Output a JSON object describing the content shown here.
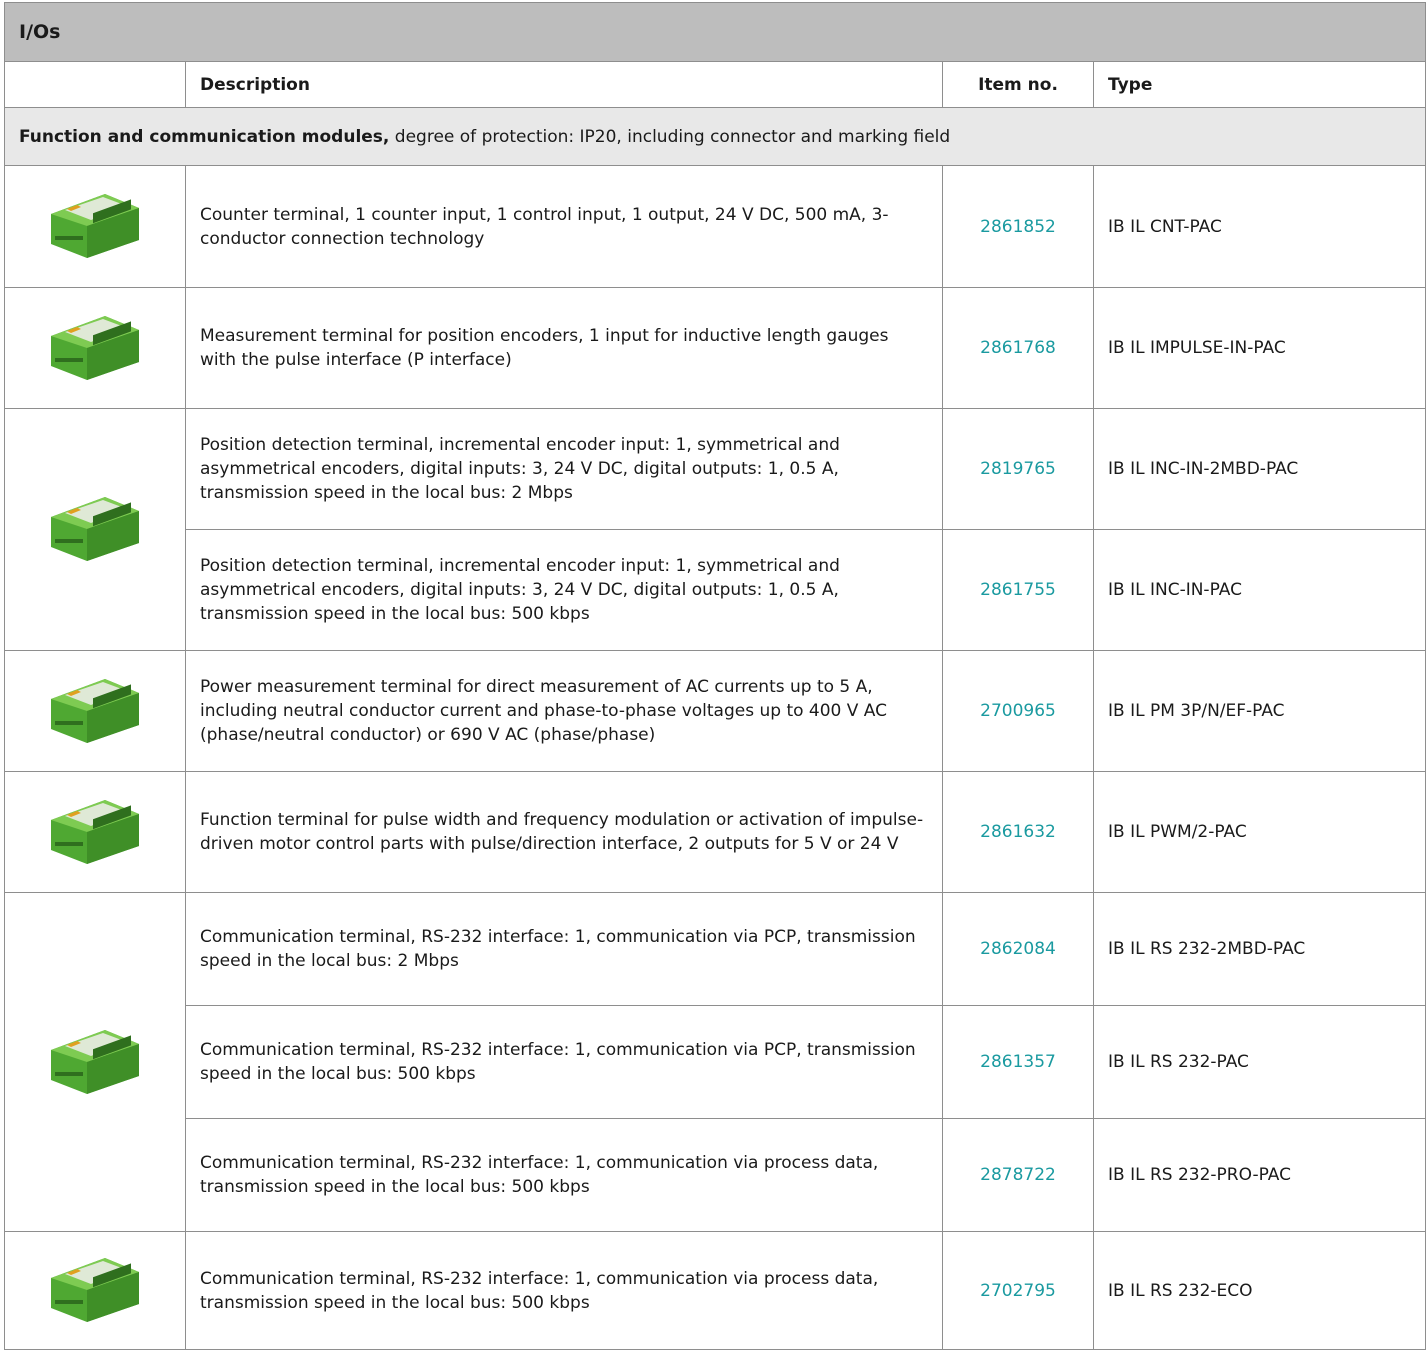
{
  "table_title": "I/Os",
  "headers": {
    "image": "",
    "description": "Description",
    "item_no": "Item no.",
    "type": "Type"
  },
  "group": {
    "title_bold": "Function and communication modules,",
    "title_rest": " degree of protection: IP20, including connector and marking field"
  },
  "rows": [
    {
      "description": "Counter terminal, 1 counter input, 1 control input, 1 output, 24 V DC, 500 mA, 3-conductor connection technology",
      "item_no": "2861852",
      "type": "IB IL CNT-PAC"
    },
    {
      "description": "Measurement terminal for position encoders, 1 input for inductive length gauges with the pulse interface (P interface)",
      "item_no": "2861768",
      "type": "IB IL IMPULSE-IN-PAC"
    },
    {
      "description": "Position detection terminal, incremental encoder input: 1, symmetrical and asymmetrical encoders, digital inputs: 3, 24 V DC, digital outputs: 1, 0.5 A, transmission speed in the local bus: 2 Mbps",
      "item_no": "2819765",
      "type": "IB IL INC-IN-2MBD-PAC"
    },
    {
      "description": "Position detection terminal, incremental encoder input: 1, symmetrical and asymmetrical encoders, digital inputs: 3, 24 V DC, digital outputs: 1, 0.5 A, transmission speed in the local bus: 500 kbps",
      "item_no": "2861755",
      "type": "IB IL INC-IN-PAC"
    },
    {
      "description": "Power measurement terminal for direct measurement of AC currents up to 5 A, including neutral conductor current and phase-to-phase voltages up to 400 V AC (phase/neutral conductor) or 690 V AC (phase/phase)",
      "item_no": "2700965",
      "type": "IB IL PM 3P/N/EF-PAC"
    },
    {
      "description": "Function terminal for pulse width and frequency modulation or activation of impulse-driven motor control parts with pulse/direction interface, 2 outputs for 5 V or 24 V",
      "item_no": "2861632",
      "type": "IB IL PWM/2-PAC"
    },
    {
      "description": "Communication terminal, RS-232 interface: 1, communication via PCP, transmission speed in the local bus: 2 Mbps",
      "item_no": "2862084",
      "type": "IB IL RS 232-2MBD-PAC"
    },
    {
      "description": "Communication terminal, RS-232 interface: 1, communication via PCP, transmission speed in the local bus: 500 kbps",
      "item_no": "2861357",
      "type": "IB IL RS 232-PAC"
    },
    {
      "description": "Communication terminal, RS-232 interface: 1, communication via process data, transmission speed in the local bus: 500 kbps",
      "item_no": "2878722",
      "type": "IB IL RS 232-PRO-PAC"
    },
    {
      "description": "Communication terminal, RS-232 interface: 1, communication via process data, transmission speed in the local bus: 500 kbps",
      "item_no": "2702795",
      "type": "IB IL RS 232-ECO"
    }
  ],
  "colors": {
    "link": "#1a9aa0",
    "title_bg": "#bdbdbd",
    "group_bg": "#e8e8e8",
    "module_green": "#5cb83c"
  }
}
